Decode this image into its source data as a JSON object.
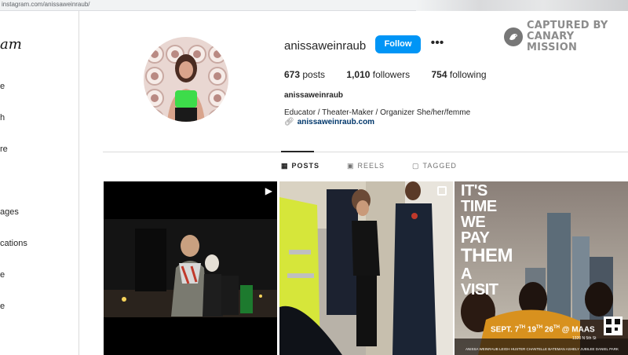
{
  "browser": {
    "url": "instagram.com/anissaweinraub/"
  },
  "sidebar": {
    "logo": "am",
    "items": [
      {
        "label": "e",
        "icon": "home-icon"
      },
      {
        "label": "h",
        "icon": "search-icon"
      },
      {
        "label": "re",
        "icon": "explore-icon"
      },
      {
        "label": "",
        "icon": "reels-icon"
      },
      {
        "label": "ages",
        "icon": "messages-icon"
      },
      {
        "label": "cations",
        "icon": "notifications-icon"
      },
      {
        "label": "e",
        "icon": "create-icon"
      },
      {
        "label": "e",
        "icon": "profile-icon"
      }
    ]
  },
  "profile": {
    "username": "anissaweinraub",
    "follow_label": "Follow",
    "more_label": "•••",
    "stats": {
      "posts_count": "673",
      "posts_label": "posts",
      "followers_count": "1,010",
      "followers_label": "followers",
      "following_count": "754",
      "following_label": "following"
    },
    "full_name": "anissaweinraub",
    "bio": "Educator / Theater-Maker / Organizer She/her/femme",
    "link": "anissaweinraub.com"
  },
  "tabs": [
    {
      "label": "POSTS",
      "icon": "grid-icon",
      "active": true
    },
    {
      "label": "REELS",
      "icon": "reels-tab-icon",
      "active": false
    },
    {
      "label": "TAGGED",
      "icon": "tagged-icon",
      "active": false
    }
  ],
  "posts": [
    {
      "type": "reel",
      "description": "photo"
    },
    {
      "type": "carousel",
      "description": "photo"
    },
    {
      "type": "image",
      "poster": {
        "line1": "IT'S",
        "line2": "TIME",
        "line3": "WE",
        "line4": "PAY",
        "line5": "THEM",
        "line6": "A",
        "line7": "VISIT",
        "date_text": "SEPT. 7",
        "date_sup1": "TH",
        "date_mid": " 19",
        "date_sup2": "TH",
        "date_mid2": " 26",
        "date_sup3": "TH",
        "date_at": " @ MAAS",
        "address": "1320 N 5th St",
        "credits": "ANISSA WEINRAUB   LEIGH HUSTER   CHANTELLE BATEMAN  ASHELY JUBILEE   DANIEL PARK"
      }
    }
  ],
  "watermark": {
    "line1": "CAPTURED BY",
    "line2": "CANARY MISSION"
  },
  "colors": {
    "follow_button": "#0095f6",
    "link": "#00376b",
    "divider": "#dbdbdb",
    "watermark": "#8c8c8c"
  }
}
